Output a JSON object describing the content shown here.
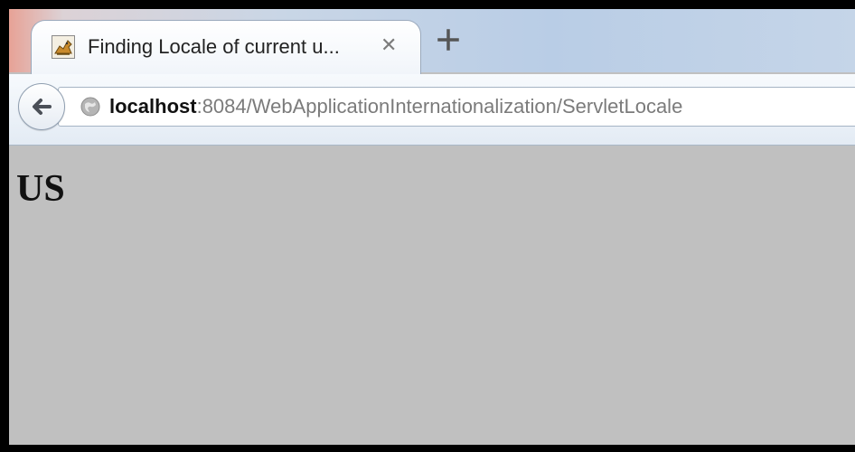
{
  "browser": {
    "tab": {
      "title": "Finding Locale of current u...",
      "close_symbol": "✕",
      "favicon": "tomcat-icon"
    },
    "new_tab_icon": "plus-icon",
    "nav": {
      "back_icon": "back-arrow-icon",
      "site_icon": "globe-icon"
    },
    "address": {
      "host": "localhost",
      "rest": ":8084/WebApplicationInternationalization/ServletLocale"
    }
  },
  "page": {
    "heading": "US",
    "background_color": "#c0c0c0"
  }
}
